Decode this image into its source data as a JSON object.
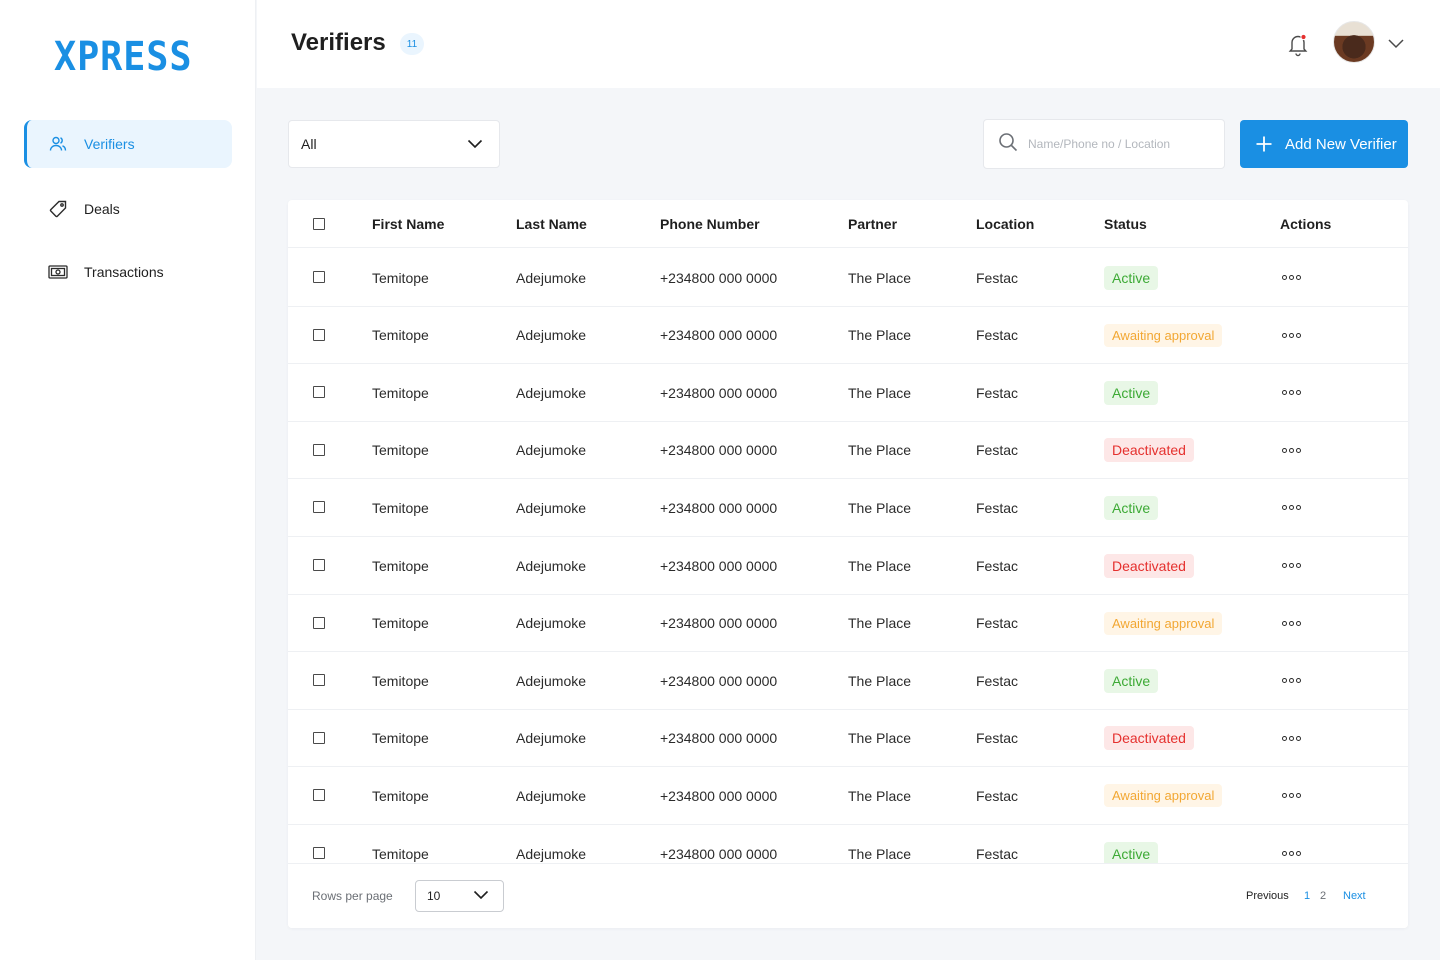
{
  "brand": {
    "logo_text": "XPRESS",
    "accent": "#1a8fe3"
  },
  "sidebar": {
    "items": [
      {
        "label": "Verifiers",
        "icon": "users-icon",
        "active": true
      },
      {
        "label": "Deals",
        "icon": "tag-icon",
        "active": false
      },
      {
        "label": "Transactions",
        "icon": "banknote-icon",
        "active": false
      }
    ]
  },
  "header": {
    "title": "Verifiers",
    "count": "11"
  },
  "toolbar": {
    "filter_value": "All",
    "search_placeholder": "Name/Phone no / Location",
    "add_button_label": "Add New Verifier"
  },
  "table": {
    "columns": [
      "First Name",
      "Last Name",
      "Phone Number",
      "Partner",
      "Location",
      "Status",
      "Actions"
    ],
    "rows": [
      {
        "first": "Temitope",
        "last": "Adejumoke",
        "phone": "+234800 000 0000",
        "partner": "The Place",
        "location": "Festac",
        "status": "Active",
        "status_type": "active"
      },
      {
        "first": "Temitope",
        "last": "Adejumoke",
        "phone": "+234800 000 0000",
        "partner": "The Place",
        "location": "Festac",
        "status": "Awaiting approval",
        "status_type": "awaiting"
      },
      {
        "first": "Temitope",
        "last": "Adejumoke",
        "phone": "+234800 000 0000",
        "partner": "The Place",
        "location": "Festac",
        "status": "Active",
        "status_type": "active"
      },
      {
        "first": "Temitope",
        "last": "Adejumoke",
        "phone": "+234800 000 0000",
        "partner": "The Place",
        "location": "Festac",
        "status": "Deactivated",
        "status_type": "deactivated"
      },
      {
        "first": "Temitope",
        "last": "Adejumoke",
        "phone": "+234800 000 0000",
        "partner": "The Place",
        "location": "Festac",
        "status": "Active",
        "status_type": "active"
      },
      {
        "first": "Temitope",
        "last": "Adejumoke",
        "phone": "+234800 000 0000",
        "partner": "The Place",
        "location": "Festac",
        "status": "Deactivated",
        "status_type": "deactivated"
      },
      {
        "first": "Temitope",
        "last": "Adejumoke",
        "phone": "+234800 000 0000",
        "partner": "The Place",
        "location": "Festac",
        "status": "Awaiting approval",
        "status_type": "awaiting"
      },
      {
        "first": "Temitope",
        "last": "Adejumoke",
        "phone": "+234800 000 0000",
        "partner": "The Place",
        "location": "Festac",
        "status": "Active",
        "status_type": "active"
      },
      {
        "first": "Temitope",
        "last": "Adejumoke",
        "phone": "+234800 000 0000",
        "partner": "The Place",
        "location": "Festac",
        "status": "Deactivated",
        "status_type": "deactivated"
      },
      {
        "first": "Temitope",
        "last": "Adejumoke",
        "phone": "+234800 000 0000",
        "partner": "The Place",
        "location": "Festac",
        "status": "Awaiting approval",
        "status_type": "awaiting"
      },
      {
        "first": "Temitope",
        "last": "Adejumoke",
        "phone": "+234800 000 0000",
        "partner": "The Place",
        "location": "Festac",
        "status": "Active",
        "status_type": "active"
      }
    ]
  },
  "footer": {
    "rows_per_page_label": "Rows per page",
    "rows_per_page_value": "10",
    "previous_label": "Previous",
    "pages": [
      "1",
      "2"
    ],
    "current_page": "1",
    "next_label": "Next"
  },
  "colors": {
    "active_text": "#3daa35",
    "active_bg": "#e8f7e6",
    "awaiting_text": "#f2a733",
    "awaiting_bg": "#fff5e6",
    "deactivated_text": "#e5302e",
    "deactivated_bg": "#fde7e7",
    "notification_dot": "#e5302e"
  }
}
